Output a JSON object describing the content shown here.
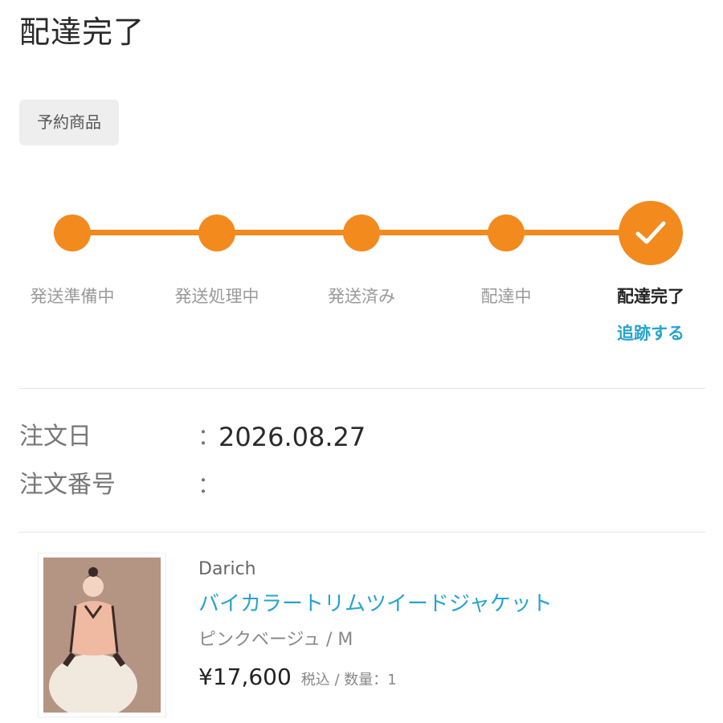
{
  "header": {
    "title": "配達完了"
  },
  "badge": {
    "label": "予約商品"
  },
  "tracker": {
    "accent_color": "#f28a1e",
    "link_color": "#27a3cf",
    "current_step": 5,
    "steps": [
      {
        "label": "発送準備中"
      },
      {
        "label": "発送処理中"
      },
      {
        "label": "発送済み"
      },
      {
        "label": "配達中"
      },
      {
        "label": "配達完了"
      }
    ],
    "track_link_label": "追跡する"
  },
  "order_info": {
    "order_date_label": "注文日",
    "order_date_colon": "：",
    "order_date_value": "2026.08.27",
    "order_number_label": "注文番号",
    "order_number_colon": "：",
    "order_number_value": ""
  },
  "product": {
    "brand": "Darich",
    "name": "バイカラートリムツイードジャケット",
    "variant": "ピンクベージュ / M",
    "price": "¥17,600",
    "tax_and_quantity": "税込 / 数量：1"
  }
}
